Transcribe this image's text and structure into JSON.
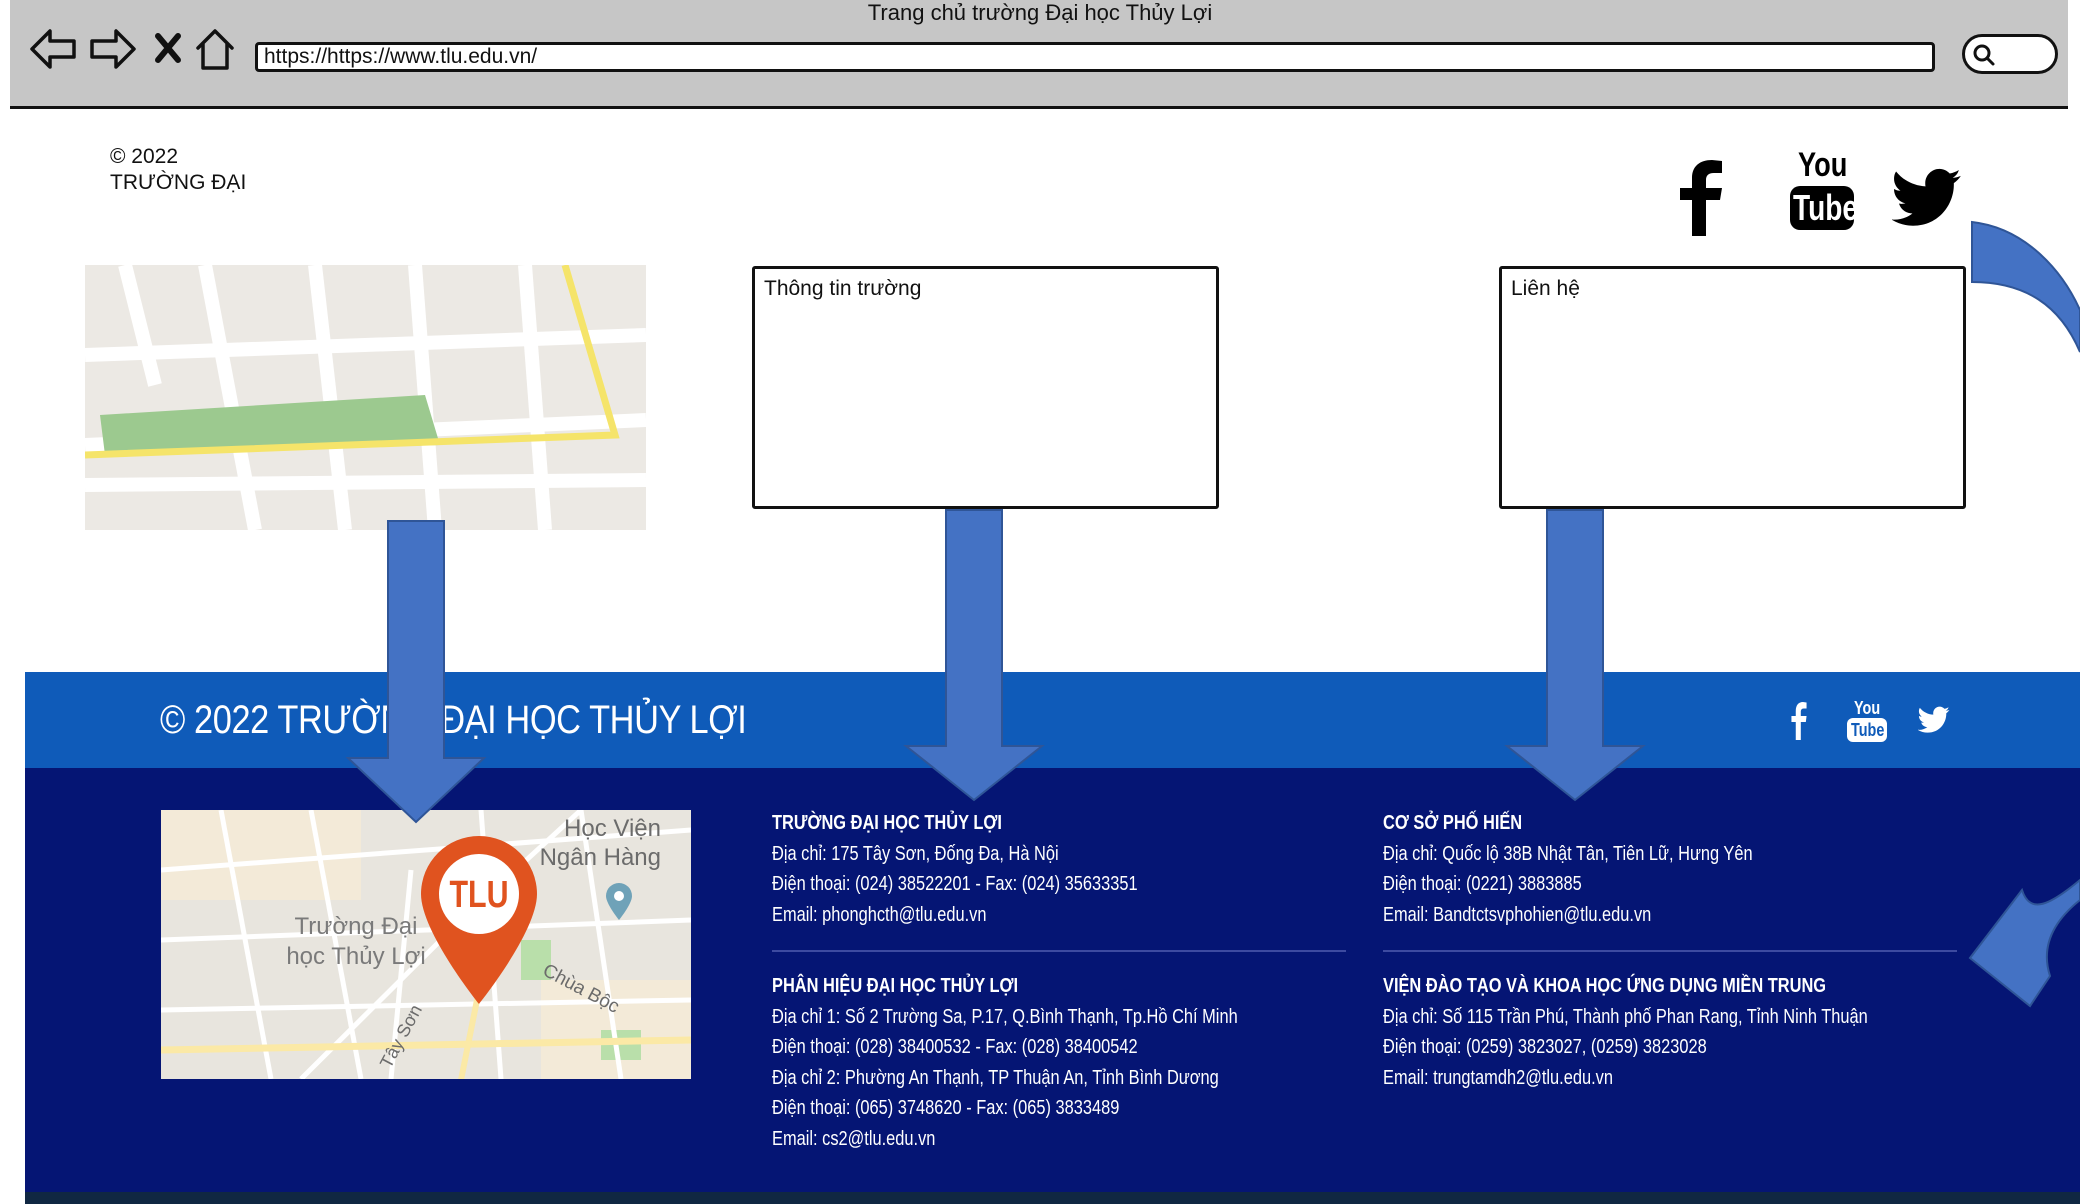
{
  "window": {
    "title": "Trang chủ trường Đại học Thủy Lợi"
  },
  "browser": {
    "url": "https://https://www.tlu.edu.vn/"
  },
  "wireframe": {
    "copyright_line1": "© 2022",
    "copyright_line2": "TRƯỜNG ĐẠI",
    "box_school_info": "Thông tin trường",
    "box_contact": "Liên hệ",
    "youtube_top": "You",
    "youtube_bottom": "Tube"
  },
  "footer": {
    "copyright": "© 2022 TRƯỜNG ĐẠI HỌC THỦY LỢI",
    "youtube_top": "You",
    "youtube_bottom": "Tube",
    "map_labels": {
      "bank_line1": "Học Viện",
      "bank_line2": "Ngân Hàng",
      "school_line1": "Trường Đại",
      "school_line2": "học Thủy Lợi",
      "pagoda": "Chùa Bộc",
      "street": "Tây Sơn",
      "pin": "TLU"
    },
    "col1": {
      "b1": {
        "heading": "TRƯỜNG ĐẠI HỌC THỦY LỢI",
        "address": "Địa chỉ: 175 Tây Sơn, Đống Đa, Hà Nội",
        "phone": "Điện thoại: (024) 38522201 - Fax: (024) 35633351",
        "email": "Email: phonghcth@tlu.edu.vn"
      },
      "b2": {
        "heading": "PHÂN HIỆU ĐẠI HỌC THỦY LỢI",
        "address1": "Địa chỉ 1: Số 2 Trường Sa, P.17, Q.Bình Thạnh, Tp.Hồ Chí Minh",
        "phone1": "Điện thoại: (028) 38400532 - Fax: (028) 38400542",
        "address2": "Địa chỉ 2: Phường An Thạnh, TP Thuận An, Tỉnh Bình Dương",
        "phone2": "Điện thoại: (065) 3748620 - Fax: (065) 3833489",
        "email": "Email: cs2@tlu.edu.vn"
      }
    },
    "col2": {
      "b1": {
        "heading": "CƠ SỞ PHỐ HIẾN",
        "address": "Địa chỉ: Quốc lộ 38B Nhật Tân, Tiên Lữ, Hưng Yên",
        "phone": "Điện thoại: (0221) 3883885",
        "email": "Email: Bandtctsvphohien@tlu.edu.vn"
      },
      "b2": {
        "heading": "VIỆN ĐÀO TẠO VÀ KHOA HỌC ỨNG DỤNG MIỀN TRUNG",
        "address": "Địa chỉ: Số 115 Trần Phú, Thành phố Phan Rang, Tỉnh Ninh Thuận",
        "phone": "Điện thoại: (0259) 3823027, (0259) 3823028",
        "email": "Email: trungtamdh2@tlu.edu.vn"
      }
    }
  },
  "colors": {
    "chrome_bg": "#c6c6c6",
    "footer_top": "#0f5bb9",
    "footer_main": "#051574",
    "arrow": "#4472c4",
    "map_pin": "#e0531f"
  },
  "icons": [
    "back-arrow-icon",
    "forward-arrow-icon",
    "close-icon",
    "home-icon",
    "search-icon",
    "facebook-icon",
    "youtube-icon",
    "twitter-icon"
  ]
}
